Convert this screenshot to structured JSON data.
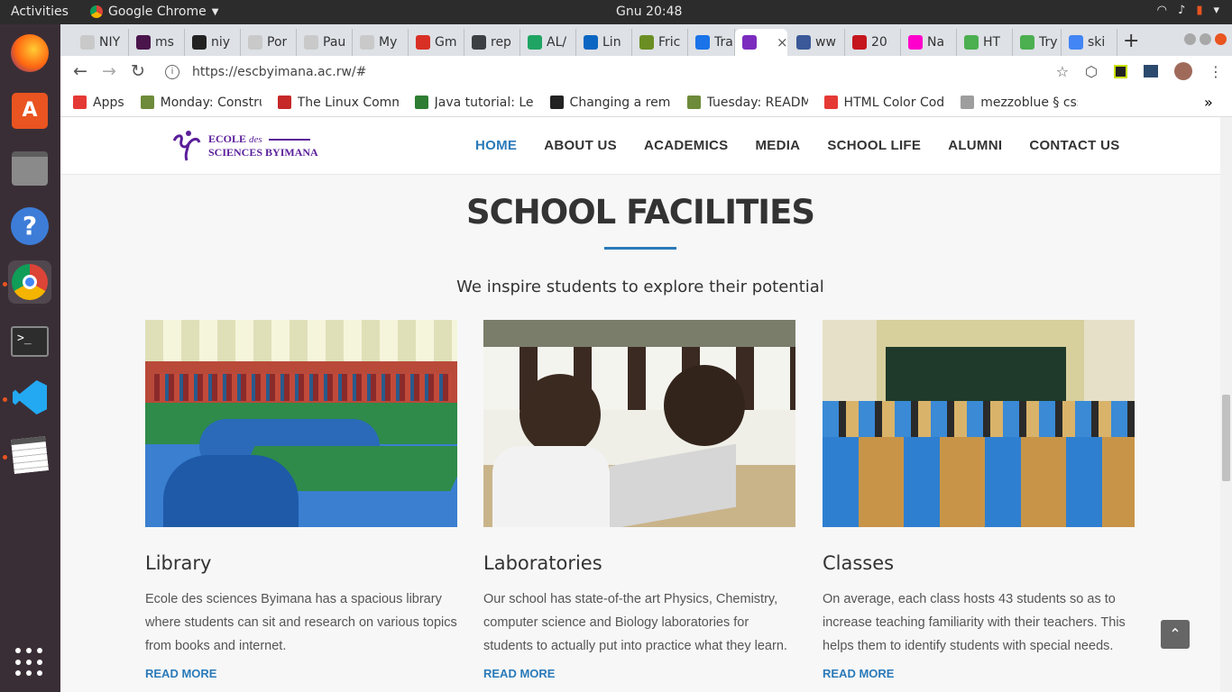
{
  "system": {
    "activities": "Activities",
    "app_name": "Google Chrome",
    "clock": "Gnu 20:48"
  },
  "browser": {
    "tabs": [
      {
        "title": "NIY",
        "color": "#c9c9c9"
      },
      {
        "title": "ms",
        "color": "#4a154b"
      },
      {
        "title": "niy",
        "color": "#222222"
      },
      {
        "title": "Por",
        "color": "#c9c9c9"
      },
      {
        "title": "Pau",
        "color": "#c9c9c9"
      },
      {
        "title": "My",
        "color": "#c9c9c9"
      },
      {
        "title": "Gm",
        "color": "#d93025"
      },
      {
        "title": "rep",
        "color": "#3c4043"
      },
      {
        "title": "AL/",
        "color": "#1fa463"
      },
      {
        "title": "Lin",
        "color": "#0a66c2"
      },
      {
        "title": "Fric",
        "color": "#6b8e23"
      },
      {
        "title": "Tra",
        "color": "#1a73e8"
      },
      {
        "title": "",
        "color": "#7b2cbf",
        "active": true
      },
      {
        "title": "ww",
        "color": "#3b5998"
      },
      {
        "title": "20",
        "color": "#c4161c"
      },
      {
        "title": "Na",
        "color": "#ff00cc"
      },
      {
        "title": "HT",
        "color": "#4caf50"
      },
      {
        "title": "Try",
        "color": "#4caf50"
      },
      {
        "title": "ski",
        "color": "#4285f4"
      }
    ],
    "close_glyph": "×",
    "new_tab": "+",
    "url": "https://escbyimana.ac.rw/#",
    "bookmarks": [
      {
        "label": "Apps",
        "color": "#e53935"
      },
      {
        "label": "Monday: Constru",
        "color": "#6d8b3a"
      },
      {
        "label": "The Linux Comm",
        "color": "#c62828"
      },
      {
        "label": "Java tutorial: Le",
        "color": "#2e7d32"
      },
      {
        "label": "Changing a remo",
        "color": "#222222"
      },
      {
        "label": "Tuesday: READM",
        "color": "#6d8b3a"
      },
      {
        "label": "HTML Color Cod",
        "color": "#e53935"
      },
      {
        "label": "mezzoblue § css",
        "color": "#9e9e9e"
      }
    ],
    "more_bookmarks": "»"
  },
  "site": {
    "logo_line1": "ECOLE",
    "logo_des": "des",
    "logo_line2": "SCIENCES BYIMANA",
    "brand_color": "#5a1e9a",
    "accent_color": "#2a7ab9",
    "menu": [
      "HOME",
      "ABOUT US",
      "ACADEMICS",
      "MEDIA",
      "SCHOOL LIFE",
      "ALUMNI",
      "CONTACT US"
    ],
    "active_menu": "HOME"
  },
  "section": {
    "title": "SCHOOL FACILITIES",
    "subtitle": "We inspire students to explore their potential",
    "cards": [
      {
        "title": "Library",
        "text": "Ecole des sciences Byimana has a spacious library where students can sit and research on various topics from books and internet.",
        "link": "READ MORE"
      },
      {
        "title": "Laboratories",
        "text": "Our school has state-of-the art Physics, Chemistry, computer science and Biology laboratories for students to actually put into practice what they learn.",
        "link": "READ MORE"
      },
      {
        "title": "Classes",
        "text": "On average, each class hosts 43 students so as to increase teaching familiarity with their teachers. This helps them to identify students with special needs.",
        "link": "READ MORE"
      }
    ]
  },
  "back_to_top": "⌃"
}
